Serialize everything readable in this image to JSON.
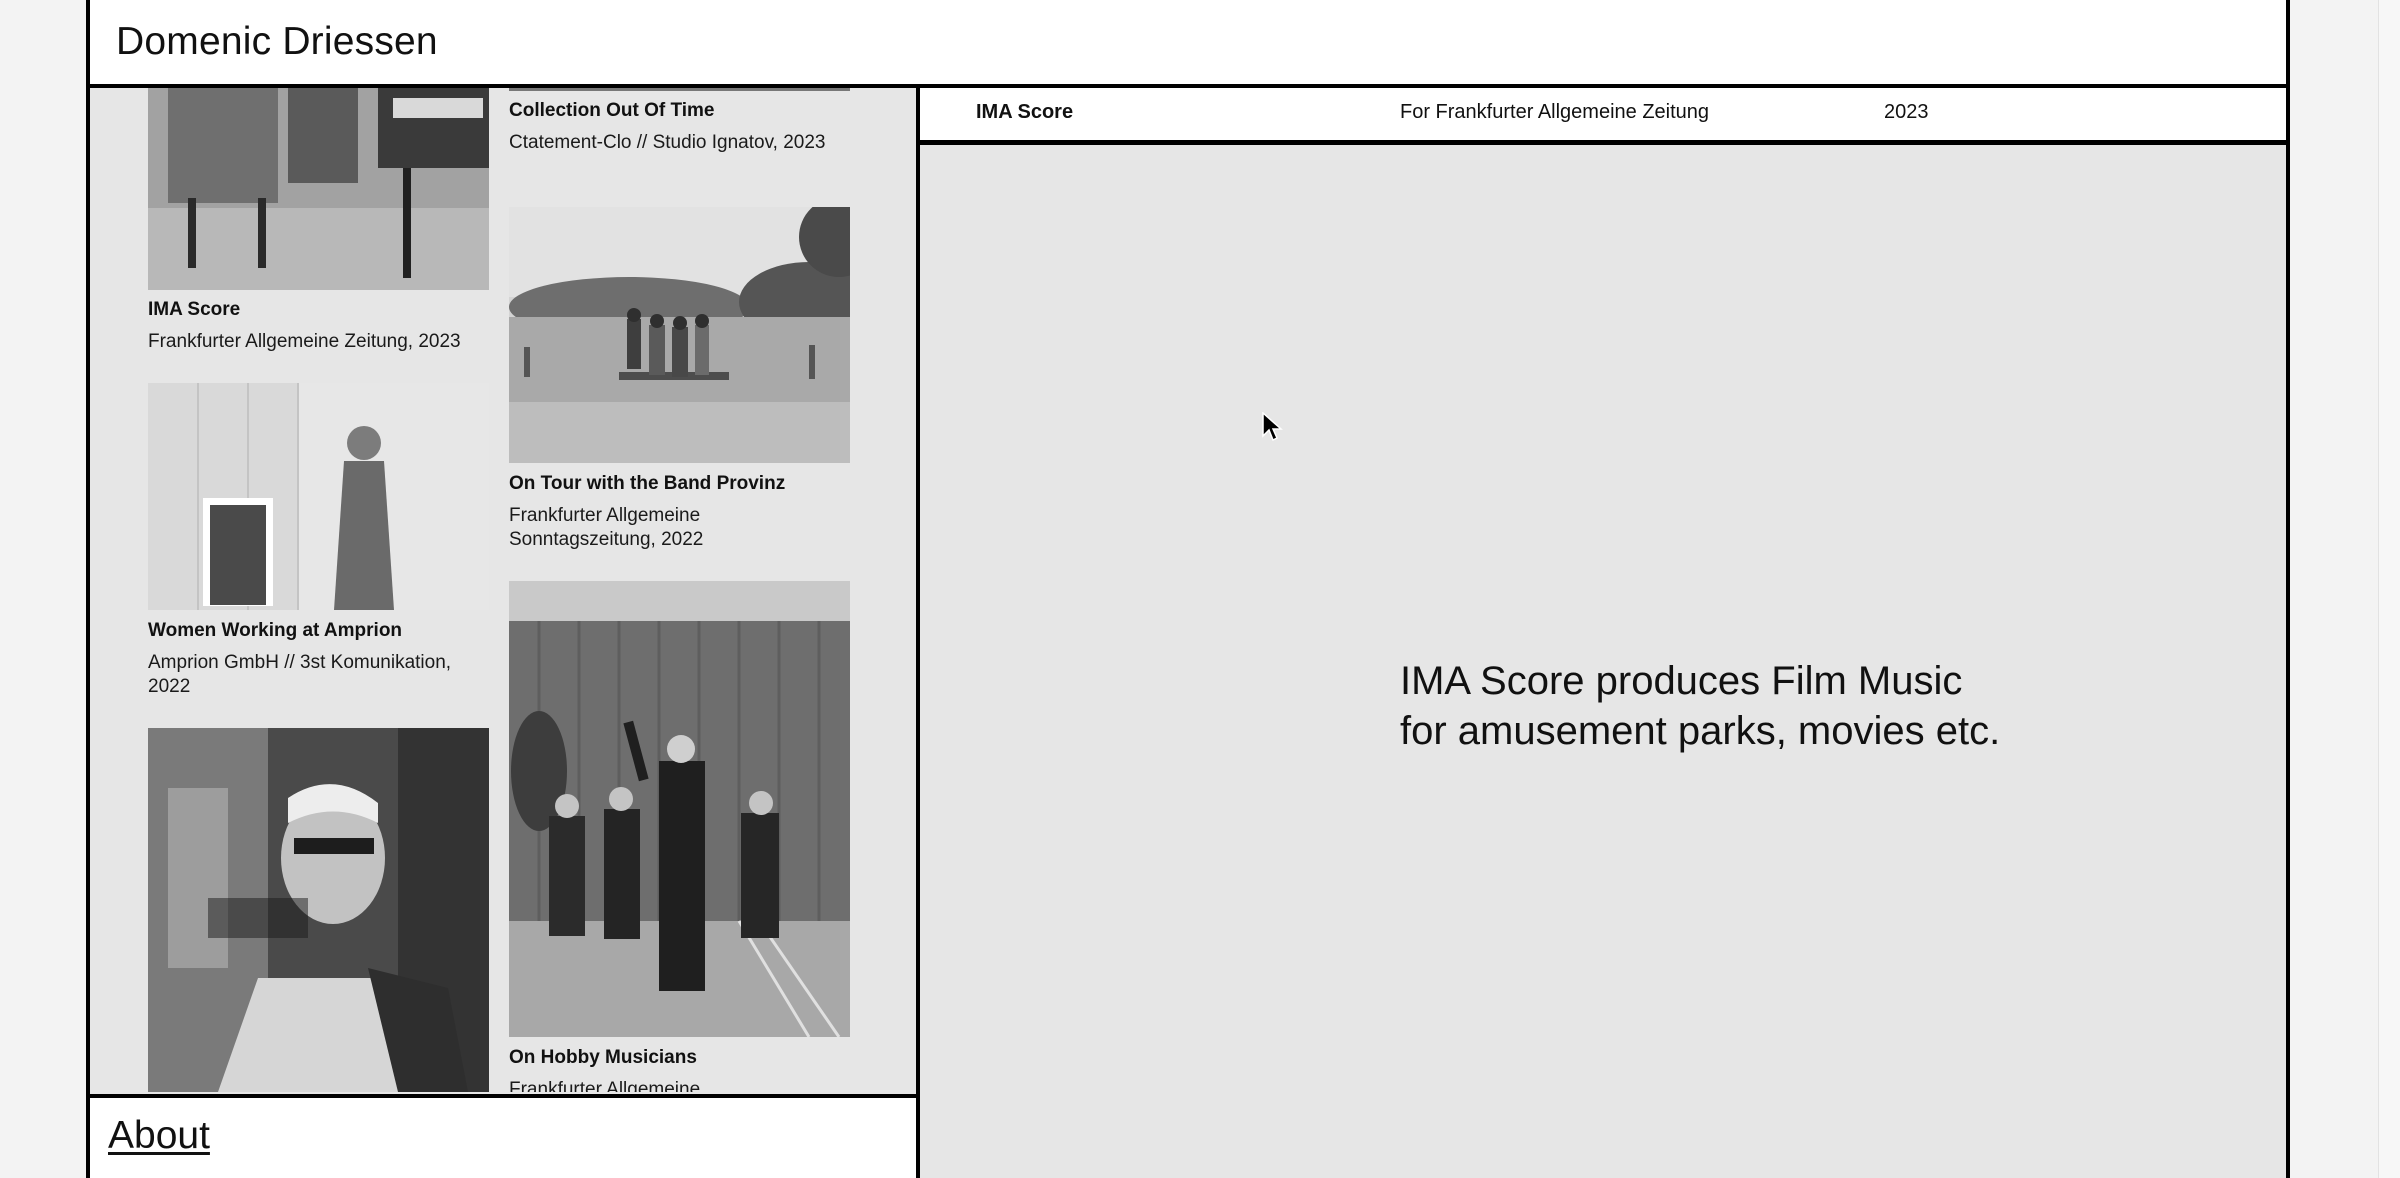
{
  "header": {
    "site_title": "Domenic Driessen"
  },
  "projects": [
    {
      "title": "",
      "subtitle": ""
    },
    {
      "title": "Collection Out Of Time",
      "subtitle": "Ctatement-Clo // Studio Ignatov, 2023"
    },
    {
      "title": "IMA Score",
      "subtitle": "Frankfurter Allgemeine Zeitung, 2023"
    },
    {
      "title": "On Tour with the Band Provinz",
      "subtitle": "Frankfurter Allgemeine Sonntagszeitung, 2022"
    },
    {
      "title": "Women Working at Amprion",
      "subtitle": "Amprion GmbH // 3st Komunikation, 2022"
    },
    {
      "title": "On Hobby Musicians",
      "subtitle": "Frankfurter Allgemeine"
    }
  ],
  "info_bar": {
    "project": "IMA Score",
    "client": "For Frankfurter Allgemeine Zeitung",
    "year": "2023"
  },
  "main": {
    "description": "IMA Score produces Film Music for amusement parks, movies etc."
  },
  "footer": {
    "about_label": "About"
  },
  "icons": {
    "cursor": "mouse-pointer-icon"
  },
  "colors": {
    "panel_bg": "#e6e6e6",
    "border": "#000000",
    "bar_bg": "#ffffff"
  }
}
